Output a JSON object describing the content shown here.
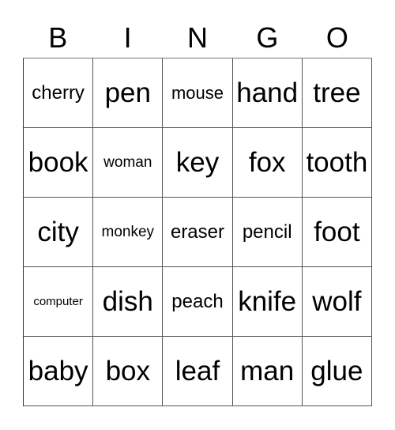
{
  "header": [
    "B",
    "I",
    "N",
    "G",
    "O"
  ],
  "cells": [
    [
      "cherry",
      "pen",
      "mouse",
      "hand",
      "tree"
    ],
    [
      "book",
      "woman",
      "key",
      "fox",
      "tooth"
    ],
    [
      "city",
      "monkey",
      "eraser",
      "pencil",
      "foot"
    ],
    [
      "computer",
      "dish",
      "peach",
      "knife",
      "wolf"
    ],
    [
      "baby",
      "box",
      "leaf",
      "man",
      "glue"
    ]
  ]
}
